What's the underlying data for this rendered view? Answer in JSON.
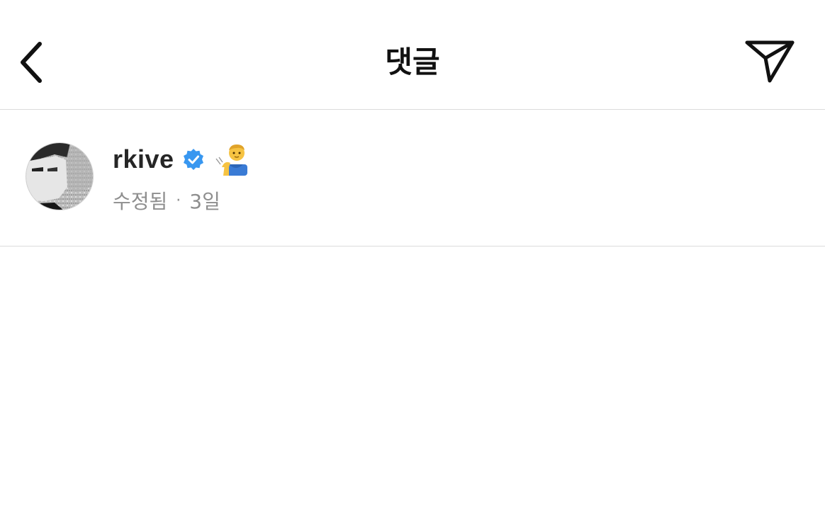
{
  "header": {
    "title": "댓글",
    "back_icon": "chevron-left-icon",
    "share_icon": "paper-plane-icon"
  },
  "comment": {
    "username": "rkive",
    "verified_icon": "verified-badge-icon",
    "verified_color": "#3897f0",
    "emoji": "man-tipping-hand-emoji",
    "edited_label": "수정됨",
    "separator": "·",
    "time_ago": "3일"
  }
}
